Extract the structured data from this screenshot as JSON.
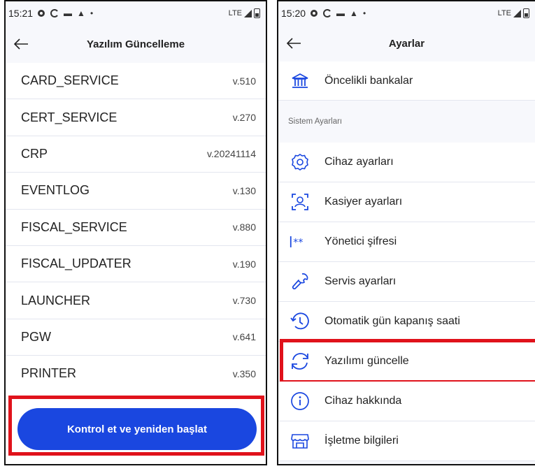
{
  "left": {
    "status": {
      "time": "15:21",
      "network": "LTE"
    },
    "title": "Yazılım Güncelleme",
    "items": [
      {
        "name": "CARD_SERVICE",
        "version": "v.510"
      },
      {
        "name": "CERT_SERVICE",
        "version": "v.270"
      },
      {
        "name": "CRP",
        "version": "v.20241114"
      },
      {
        "name": "EVENTLOG",
        "version": "v.130"
      },
      {
        "name": "FISCAL_SERVICE",
        "version": "v.880"
      },
      {
        "name": "FISCAL_UPDATER",
        "version": "v.190"
      },
      {
        "name": "LAUNCHER",
        "version": "v.730"
      },
      {
        "name": "PGW",
        "version": "v.641"
      },
      {
        "name": "PRINTER",
        "version": "v.350"
      }
    ],
    "button_label": "Kontrol et ve yeniden başlat"
  },
  "right": {
    "status": {
      "time": "15:20",
      "network": "LTE"
    },
    "title": "Ayarlar",
    "top_item": {
      "label": "Öncelikli bankalar",
      "icon": "bank-icon"
    },
    "section_label": "Sistem Ayarları",
    "items": [
      {
        "label": "Cihaz ayarları",
        "icon": "gear-icon"
      },
      {
        "label": "Kasiyer ayarları",
        "icon": "cashier-icon"
      },
      {
        "label": "Yönetici şifresi",
        "icon": "password-icon"
      },
      {
        "label": "Servis ayarları",
        "icon": "wrench-icon"
      },
      {
        "label": "Otomatik gün kapanış saati",
        "icon": "history-clock-icon"
      },
      {
        "label": "Yazılımı güncelle",
        "icon": "refresh-icon"
      },
      {
        "label": "Cihaz hakkında",
        "icon": "info-icon"
      },
      {
        "label": "İşletme bilgileri",
        "icon": "store-icon"
      }
    ]
  },
  "colors": {
    "accent": "#1a47e0",
    "highlight": "#e0121b"
  }
}
